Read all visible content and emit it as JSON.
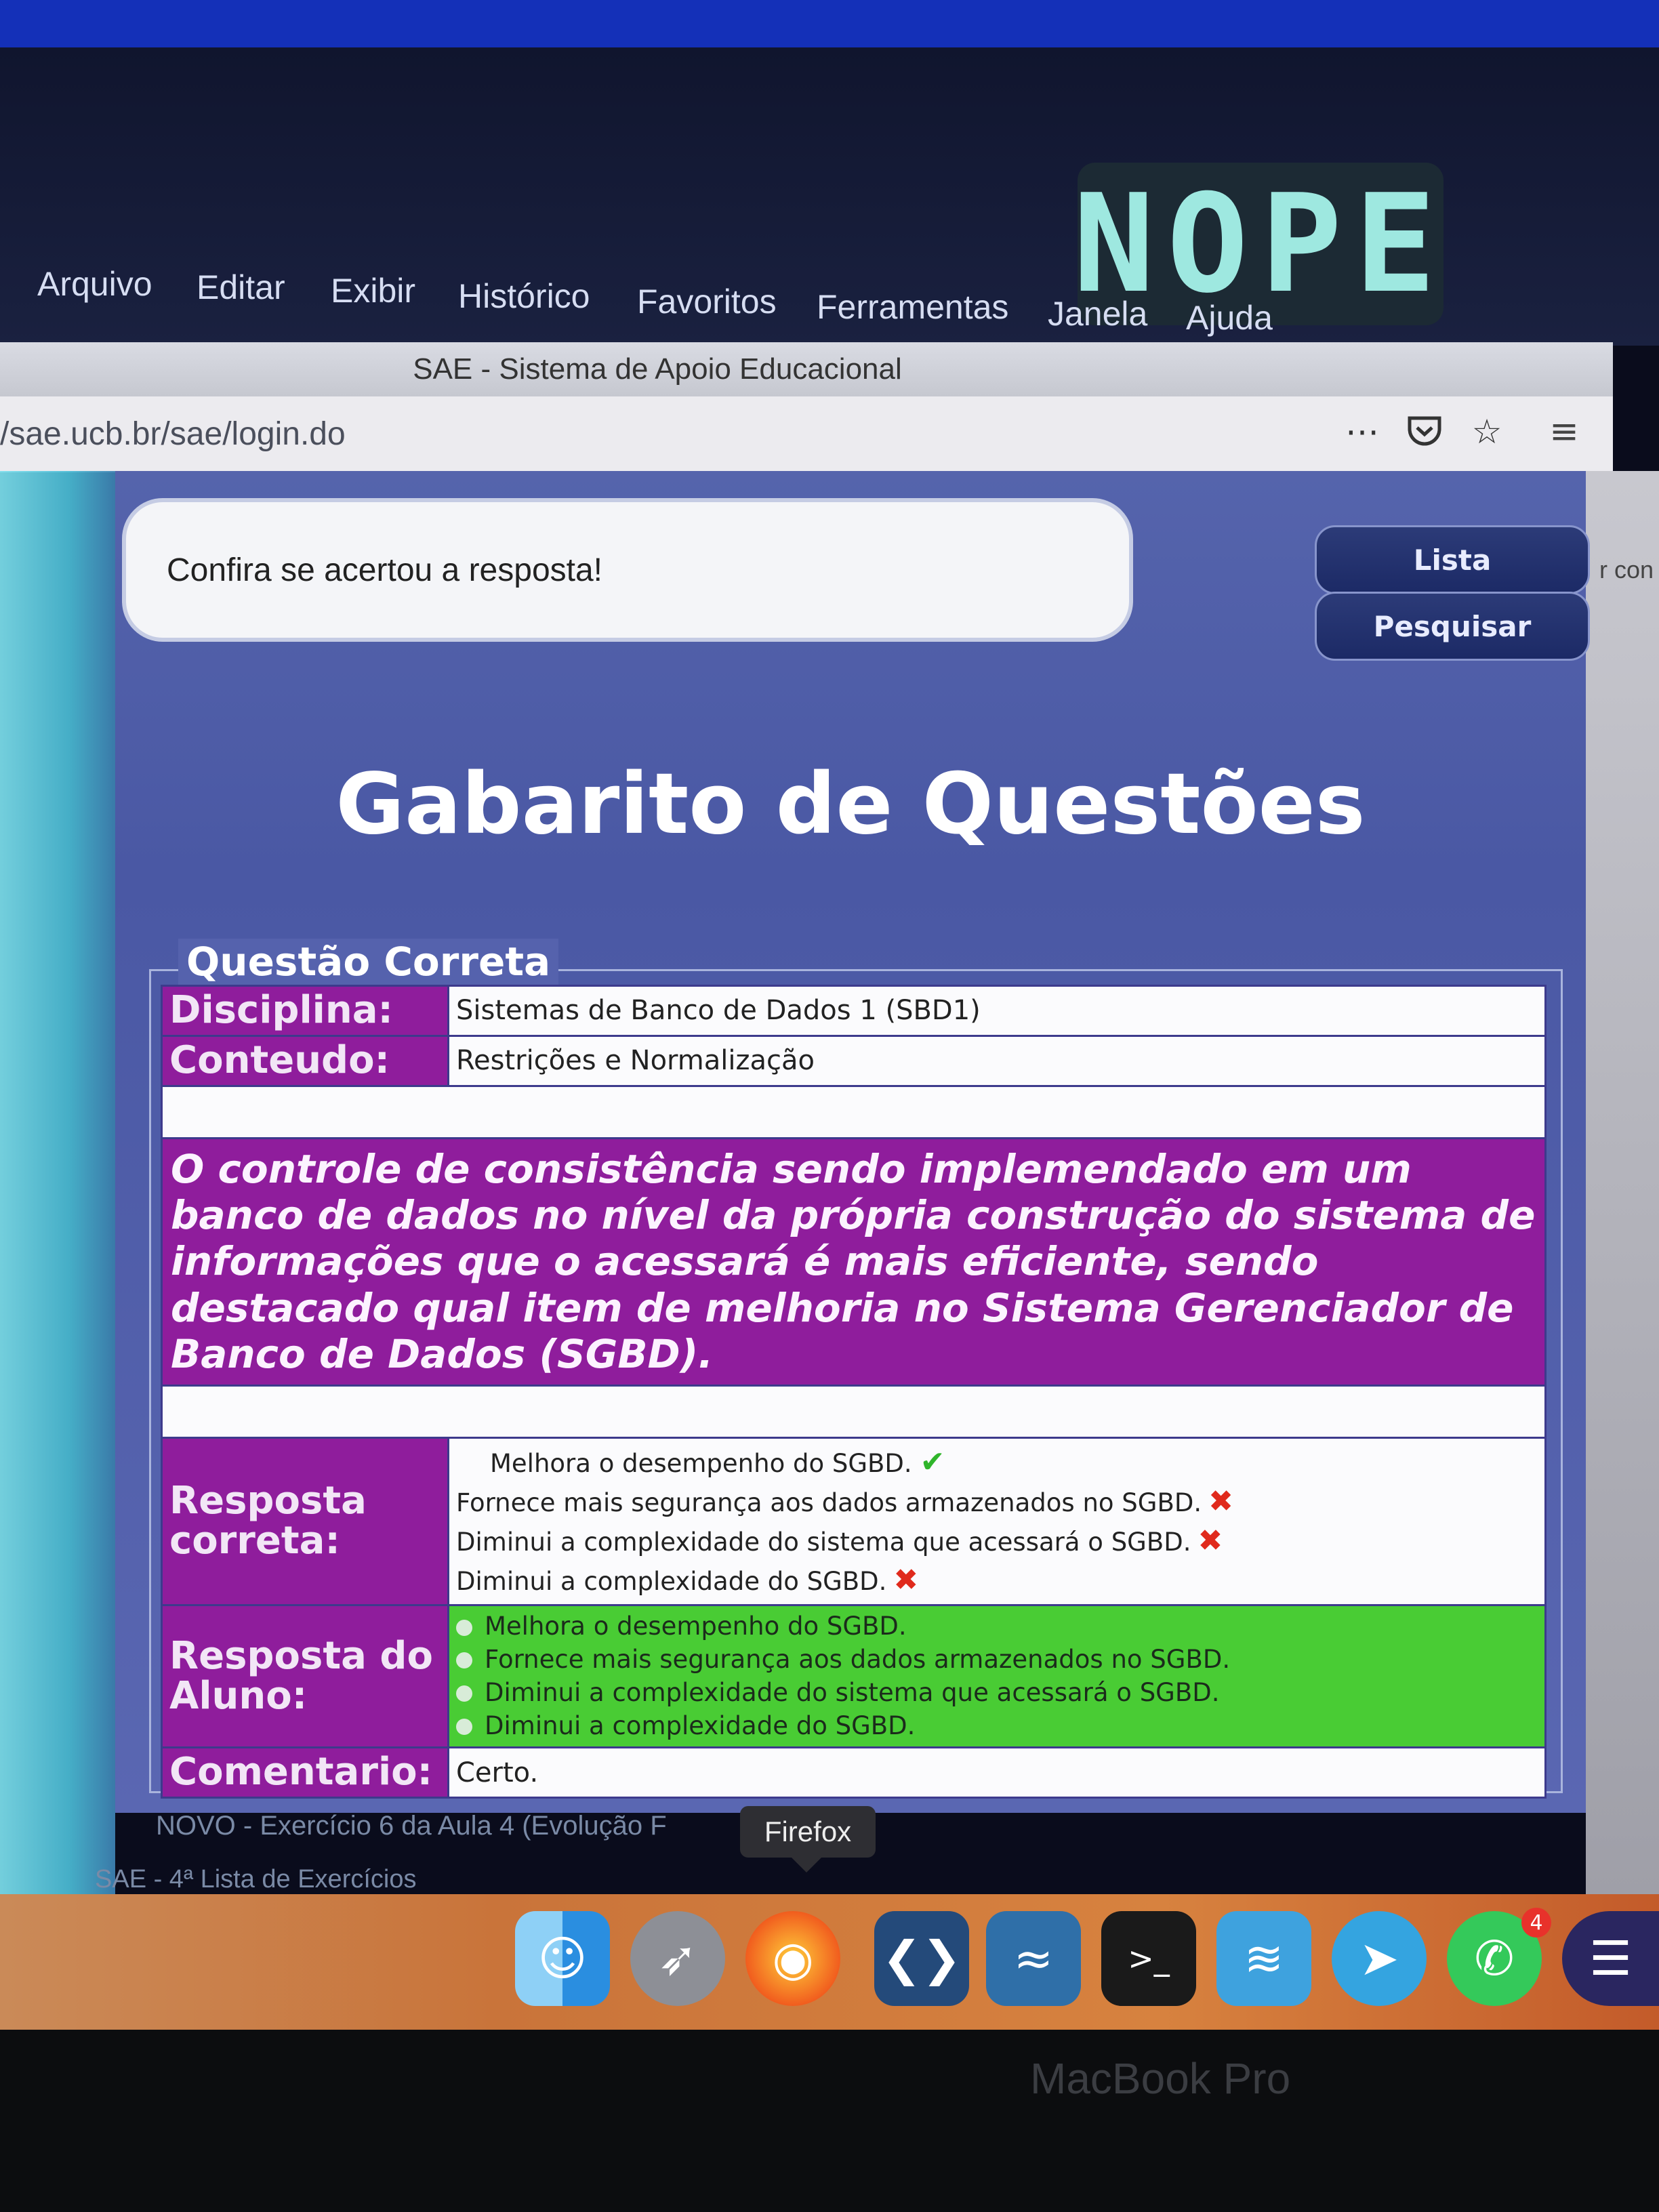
{
  "logo": {
    "text": "NOPE"
  },
  "menu": [
    "Arquivo",
    "Editar",
    "Exibir",
    "Histórico",
    "Favoritos",
    "Ferramentas",
    "Janela",
    "Ajuda"
  ],
  "browser": {
    "title": "SAE - Sistema de Apoio Educacional",
    "url": "/sae.ucb.br/sae/login.do",
    "icons": [
      "more-icon",
      "pocket-icon",
      "bookmark-star-icon",
      "hamburger-menu-icon"
    ]
  },
  "right_edge_text": "r con",
  "page": {
    "message": "Confira se acertou a resposta!",
    "nav": {
      "lista": "Lista",
      "pesquisar": "Pesquisar"
    },
    "title": "Gabarito de Questões",
    "legend": "Questão Correta",
    "disciplina_label": "Disciplina:",
    "disciplina_value": "Sistemas de Banco de Dados 1 (SBD1)",
    "conteudo_label": "Conteudo:",
    "conteudo_value": "Restrições e Normalização",
    "question": "O controle de consistência sendo implemendado em um banco de dados no nível da própria construção do sistema de informações que o acessará é mais eficiente, sendo destacado qual item de melhoria no Sistema Gerenciador de Banco de Dados (SGBD).",
    "correct_label": "Resposta correta:",
    "correct_options": [
      {
        "text": "Melhora o desempenho do SGBD.",
        "mark": "check-icon"
      },
      {
        "text": "Fornece mais segurança aos dados armazenados no SGBD.",
        "mark": "cross-icon"
      },
      {
        "text": "Diminui a complexidade do sistema que acessará o SGBD.",
        "mark": "cross-icon"
      },
      {
        "text": "Diminui a complexidade do SGBD.",
        "mark": "cross-icon"
      }
    ],
    "student_label": "Resposta do Aluno:",
    "student_options": [
      "Melhora o desempenho do SGBD.",
      "Fornece mais segurança aos dados armazenados no SGBD.",
      "Diminui a complexidade do sistema que acessará o SGBD.",
      "Diminui a complexidade do SGBD."
    ],
    "comment_label": "Comentario:",
    "comment_value": "Certo."
  },
  "below": {
    "line1": "NOVO - Exercício 6 da Aula 4 (Evolução F",
    "line2": "SAE - 4ª Lista de Exercícios"
  },
  "tooltip": "Firefox",
  "dock": [
    "finder-icon",
    "launchpad-icon",
    "firefox-icon",
    "vscode-icon",
    "mysql-workbench-icon",
    "terminal-icon",
    "docker-icon",
    "telegram-icon",
    "whatsapp-icon",
    "eclipse-icon"
  ],
  "whatsapp_badge": "4",
  "bezel_text": "MacBook Pro",
  "colors": {
    "purple_label": "#8f1d9c",
    "green_answer": "#49cc34",
    "page_blue": "#5562ad"
  }
}
